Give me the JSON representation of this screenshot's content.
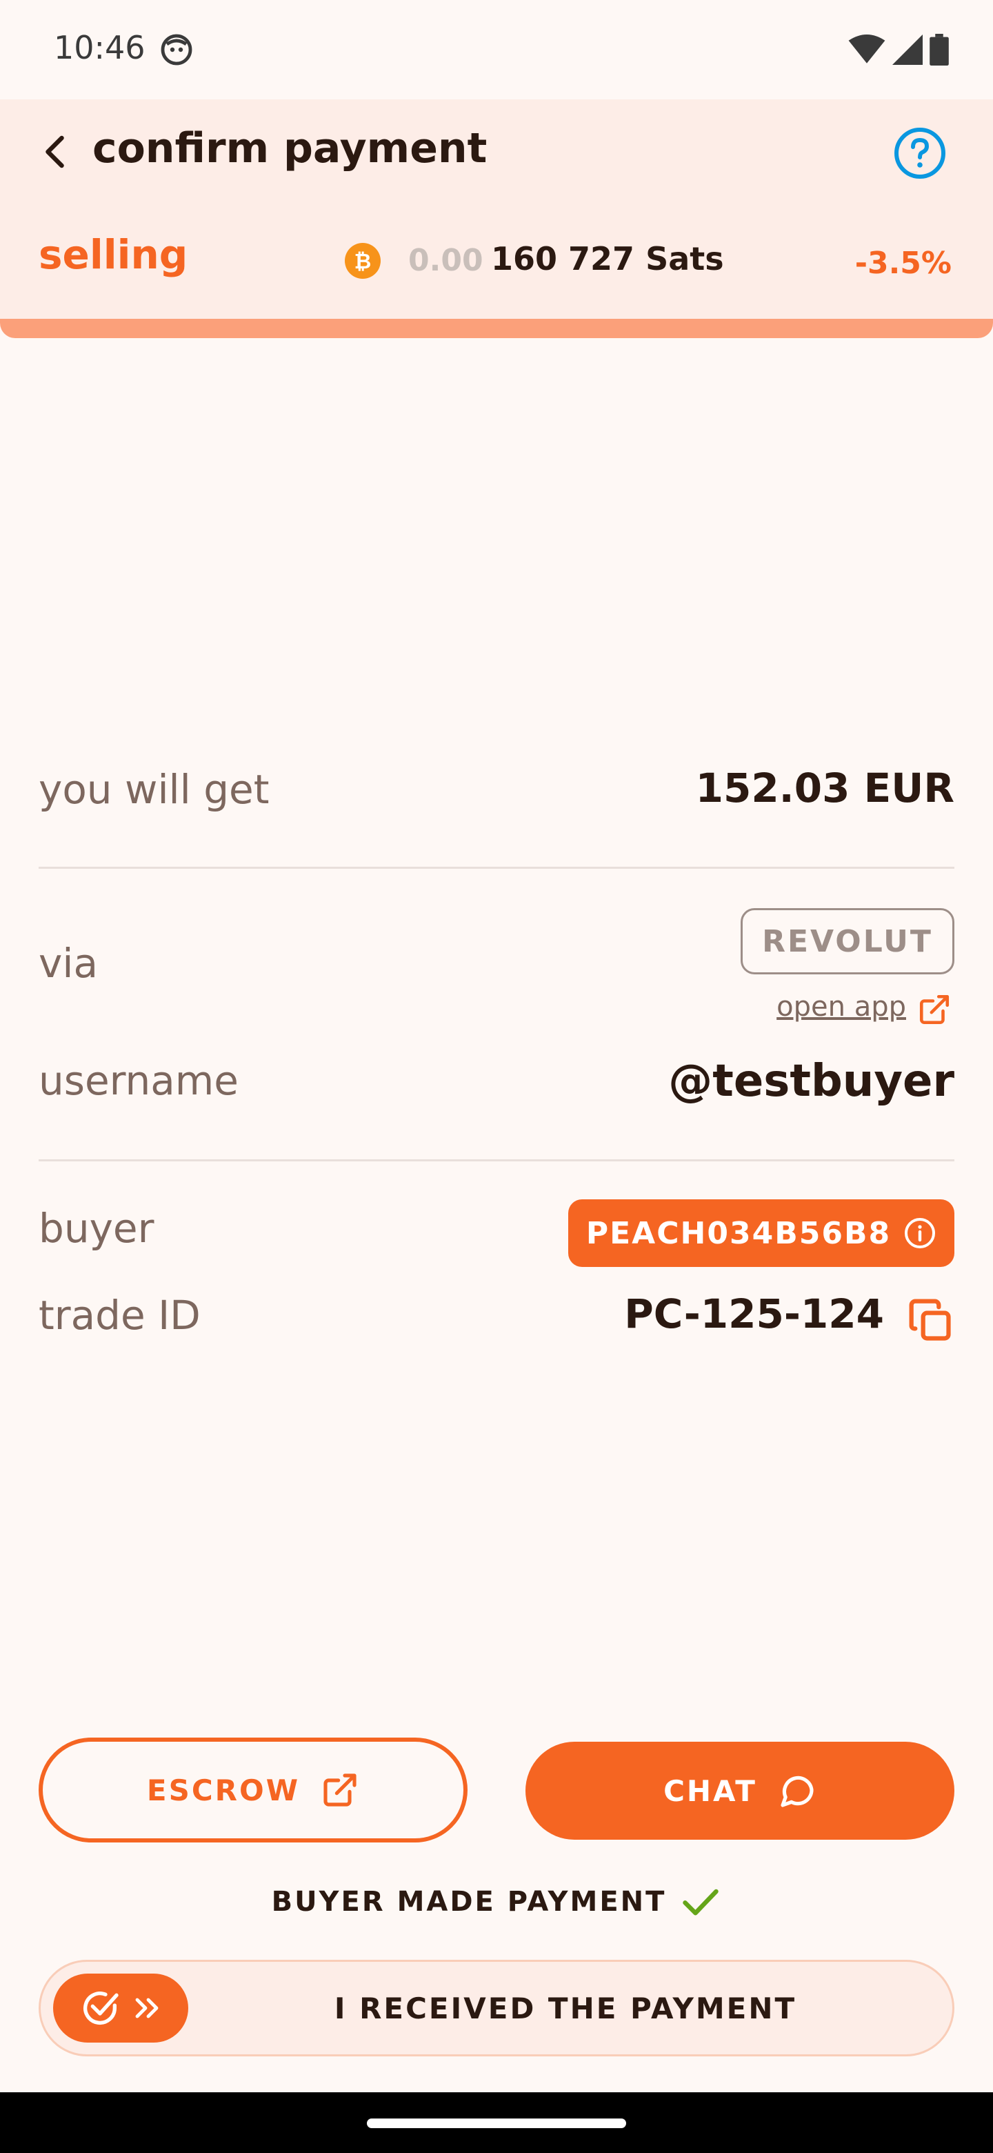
{
  "status_bar": {
    "time": "10:46"
  },
  "header": {
    "title": "confirm payment",
    "mode": "selling",
    "sats_prefix": "0.00",
    "sats_amount": "160 727 Sats",
    "premium": "-3.5%"
  },
  "details": {
    "amount_label": "you will get",
    "amount_value": "152.03 EUR",
    "via_label": "via",
    "method": "REVOLUT",
    "open_app": "open app",
    "username_label": "username",
    "username_value": "@testbuyer",
    "buyer_label": "buyer",
    "buyer_id": "PEACH034B56B8",
    "trade_label": "trade ID",
    "trade_id": "PC-125-124"
  },
  "actions": {
    "escrow": "ESCROW",
    "chat": "CHAT",
    "payment_status": "BUYER MADE PAYMENT",
    "confirm_slider": "I RECEIVED THE PAYMENT"
  },
  "colors": {
    "primary": "#F56522",
    "background": "#FEF8F5",
    "header": "#FDEDE7",
    "success": "#65A519",
    "help": "#0A97E0"
  }
}
